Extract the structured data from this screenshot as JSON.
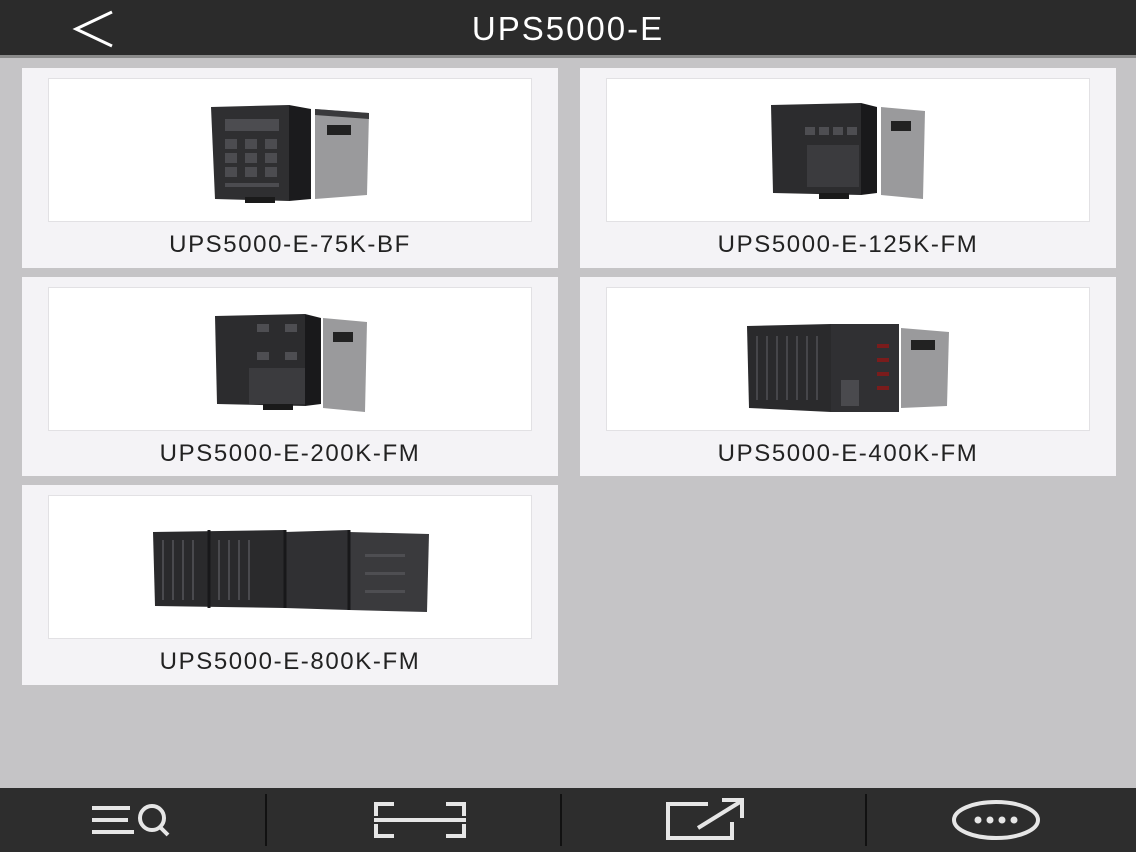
{
  "header": {
    "title": "UPS5000-E"
  },
  "products": [
    {
      "label": "UPS5000-E-75K-BF"
    },
    {
      "label": "UPS5000-E-125K-FM"
    },
    {
      "label": "UPS5000-E-200K-FM"
    },
    {
      "label": "UPS5000-E-400K-FM"
    },
    {
      "label": "UPS5000-E-800K-FM"
    }
  ],
  "toolbar": {
    "icons": [
      "list-search-icon",
      "scan-icon",
      "share-icon",
      "more-icon"
    ]
  },
  "colors": {
    "header_bg": "#2b2b2b",
    "page_bg": "#c5c4c6",
    "card_bg": "#f4f3f6",
    "toolbar_bg": "#2d2d2d"
  }
}
